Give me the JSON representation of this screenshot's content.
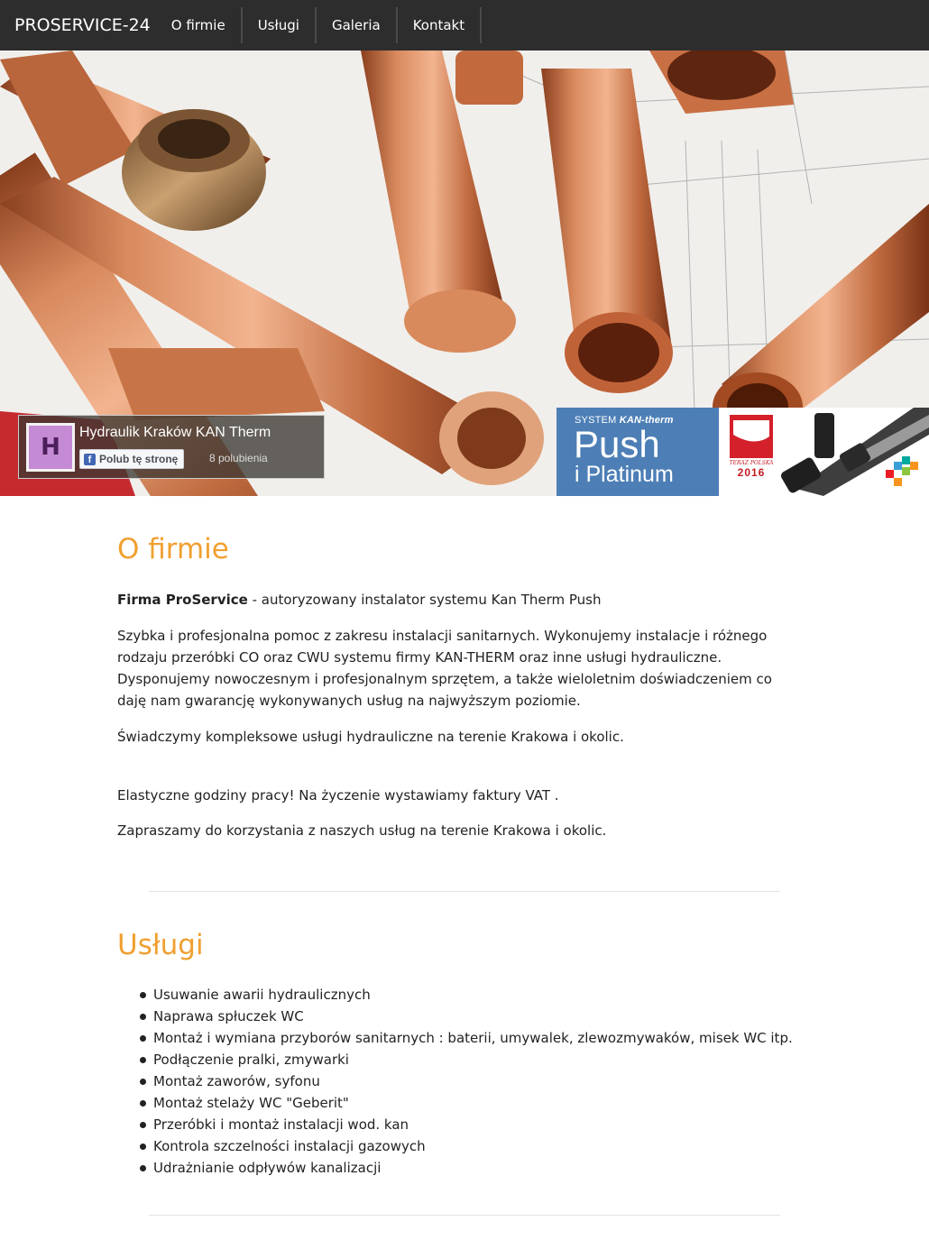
{
  "navbar": {
    "brand": "PROSERVICE-24",
    "items": [
      {
        "label": "O firmie"
      },
      {
        "label": "Usługi"
      },
      {
        "label": "Galeria"
      },
      {
        "label": "Kontakt"
      }
    ]
  },
  "facebook": {
    "avatar_letter": "H",
    "page_name": "Hydraulik Kraków KAN Therm",
    "like_label": "Polub tę stronę",
    "likes": "8 polubienia"
  },
  "banner": {
    "system_prefix": "SYSTEM",
    "system_brand": "KAN-therm",
    "push": "Push",
    "platinum": "i Platinum",
    "teraz_polska": "TERAZ POLSKA",
    "year": "2016"
  },
  "about": {
    "title": "O firmie",
    "intro_bold": "Firma ProService",
    "intro_rest": " - autoryzowany instalator systemu Kan Therm Push",
    "p1": "Szybka i profesjonalna pomoc z zakresu instalacji sanitarnych. Wykonujemy instalacje i różnego rodzaju przeróbki CO oraz CWU systemu firmy KAN-THERM oraz inne usługi hydrauliczne. Dysponujemy nowoczesnym i profesjonalnym sprzętem, a także wieloletnim doświadczeniem co daję nam gwarancję wykonywanych usług na najwyższym poziomie.",
    "p2": "Świadczymy kompleksowe usługi hydrauliczne na terenie Krakowa i okolic.",
    "p3": "Elastyczne godziny pracy! Na życzenie wystawiamy faktury VAT .",
    "p4": "Zapraszamy do korzystania z naszych usług na terenie Krakowa i okolic."
  },
  "services": {
    "title": "Usługi",
    "items": [
      "Usuwanie awarii hydraulicznych",
      "Naprawa spłuczek WC",
      "Montaż i wymiana przyborów sanitarnych : baterii, umywalek, zlewozmywaków, misek WC itp.",
      "Podłączenie pralki, zmywarki",
      "Montaż zaworów, syfonu",
      "Montaż stelaży WC \"Geberit\"",
      "Przeróbki i montaż instalacji wod. kan",
      "Kontrola szczelności instalacji gazowych",
      "Udrażnianie odpływów kanalizacji"
    ]
  },
  "colors": {
    "navbar_bg": "#2d2d2d",
    "accent": "#f0a030",
    "push_blue": "#4d7fb6",
    "copper": "#c8744a"
  }
}
